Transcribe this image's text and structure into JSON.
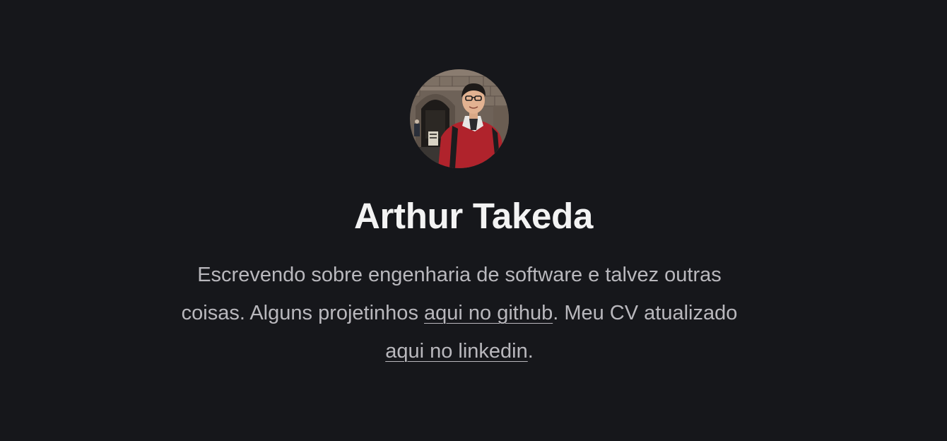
{
  "profile": {
    "name": "Arthur Takeda",
    "bio_part1": "Escrevendo sobre engenharia de software e talvez outras coisas. Alguns projetinhos ",
    "github_link_text": "aqui no github",
    "bio_part2": ". Meu CV atualizado ",
    "linkedin_link_text": "aqui no linkedin",
    "bio_part3": "."
  },
  "colors": {
    "background": "#16171b",
    "name_text": "#f3f3f3",
    "body_text": "#b9b8bd"
  }
}
